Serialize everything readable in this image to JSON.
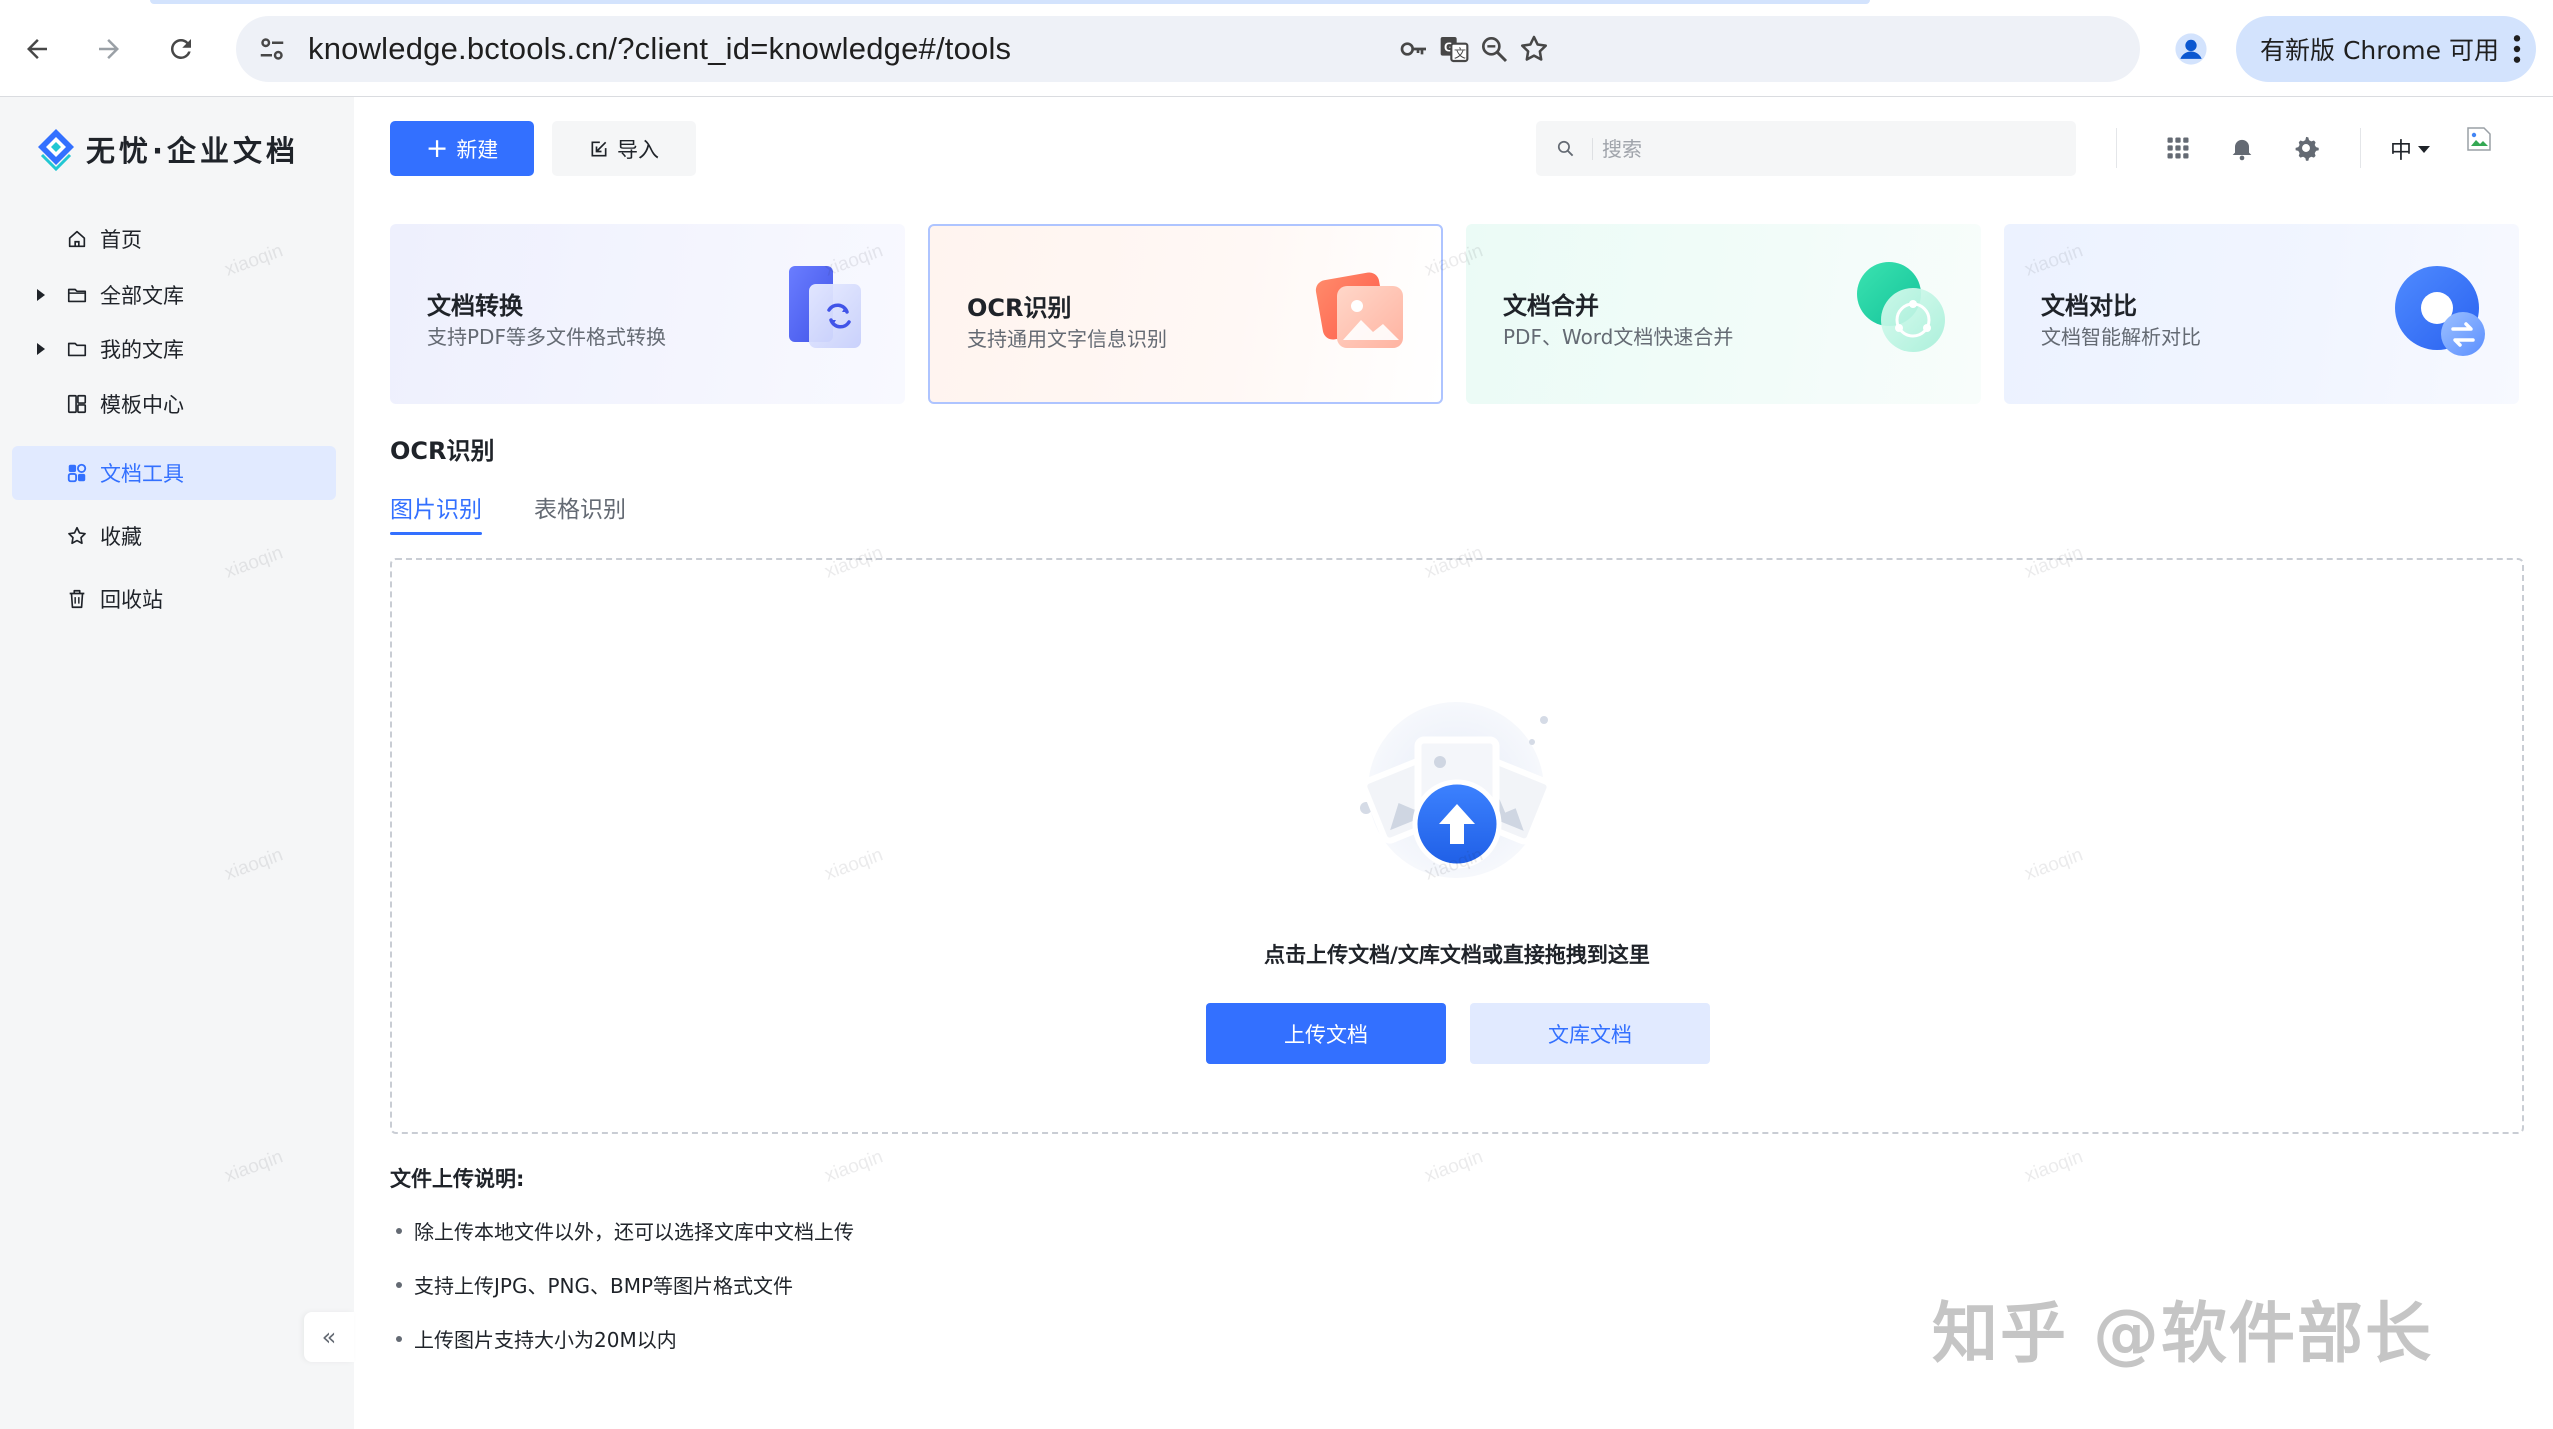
{
  "browser": {
    "url": "knowledge.bctools.cn/?client_id=knowledge#/tools",
    "update_button_label": "有新版 Chrome 可用"
  },
  "app": {
    "logo_text": "无忧·企业文档"
  },
  "sidebar": {
    "items": [
      {
        "label": "首页",
        "icon": "home-icon"
      },
      {
        "label": "全部文库",
        "icon": "folder-icon"
      },
      {
        "label": "我的文库",
        "icon": "folder-icon"
      },
      {
        "label": "模板中心",
        "icon": "template-icon"
      },
      {
        "label": "文档工具",
        "icon": "tools-icon",
        "active": true
      },
      {
        "label": "收藏",
        "icon": "star-icon"
      },
      {
        "label": "回收站",
        "icon": "trash-icon"
      }
    ],
    "collapse_glyph": "«"
  },
  "toolbar": {
    "new_label": "新建",
    "import_label": "导入",
    "search_placeholder": "搜索",
    "language": "中"
  },
  "tool_cards": [
    {
      "title": "文档转换",
      "desc": "支持PDF等多文件格式转换"
    },
    {
      "title": "OCR识别",
      "desc": "支持通用文字信息识别",
      "selected": true
    },
    {
      "title": "文档合并",
      "desc": "PDF、Word文档快速合并"
    },
    {
      "title": "文档对比",
      "desc": "文档智能解析对比"
    }
  ],
  "ocr": {
    "section_title": "OCR识别",
    "tabs": [
      {
        "label": "图片识别",
        "active": true
      },
      {
        "label": "表格识别"
      }
    ],
    "drop_hint": "点击上传文档/文库文档或直接拖拽到这里",
    "upload_button": "上传文档",
    "library_button": "文库文档"
  },
  "notes": {
    "title": "文件上传说明:",
    "items": [
      "除上传本地文件以外，还可以选择文库中文档上传",
      "支持上传JPG、PNG、BMP等图片格式文件",
      "上传图片支持大小为20M以内"
    ]
  },
  "watermark_text": "xiaoqin",
  "corner_watermark": "知乎 @软件部长",
  "colors": {
    "primary": "#3370ff",
    "primary_light": "#e1eaff",
    "sidebar_bg": "#f5f6f7",
    "chrome_accent": "#d3e3fd"
  }
}
